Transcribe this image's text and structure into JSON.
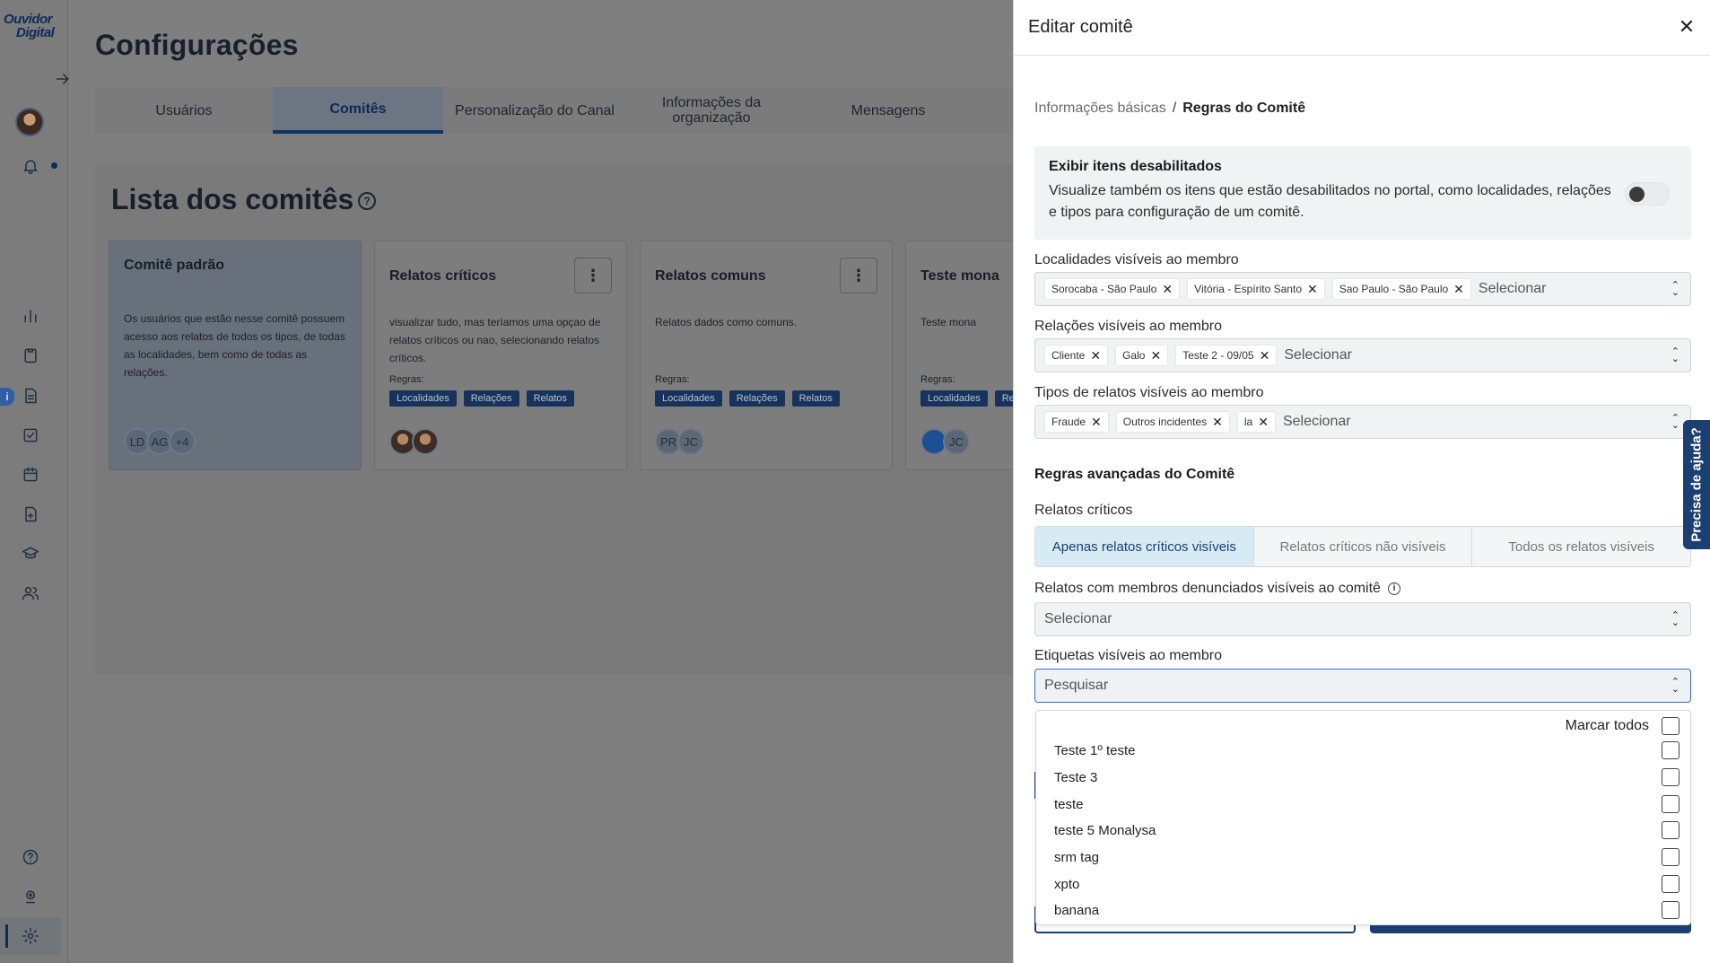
{
  "app": {
    "logo_line1": "Ouvidor",
    "logo_line2": "Digital",
    "page_title": "Configurações"
  },
  "tabs": [
    {
      "label": "Usuários"
    },
    {
      "label": "Comitês",
      "active": true
    },
    {
      "label": "Personalização do Canal"
    },
    {
      "label": "Informações da organização"
    },
    {
      "label": "Mensagens"
    }
  ],
  "committees_section": {
    "title": "Lista dos comitês",
    "help_icon": "help-circle-icon",
    "rules_label": "Regras:",
    "rule_tags": [
      "Localidades",
      "Relações",
      "Relatos"
    ],
    "cards": [
      {
        "title": "Comitê padrão",
        "description": "Os usuários que estão nesse comitê possuem acesso aos relatos de todos os tipos, de todas as localidades, bem como de todas as relações.",
        "avatars": [
          "LD",
          "AG",
          "+4"
        ]
      },
      {
        "title": "Relatos críticos",
        "description": "visualizar tudo, mas teríamos uma opçao de relatos críticos ou nao, selecionando relatos críticos.",
        "menu": "⋮"
      },
      {
        "title": "Relatos comuns",
        "description": "Relatos dados como comuns.",
        "avatars": [
          "PR",
          "JC"
        ],
        "menu": "⋮"
      },
      {
        "title": "Teste mona",
        "description": "Teste mona",
        "avatars": [
          "JC"
        ]
      }
    ]
  },
  "drawer": {
    "title": "Editar comitê",
    "close_icon": "close-icon",
    "breadcrumb": {
      "step1": "Informações básicas",
      "separator": "/",
      "step2": "Regras do Comitê"
    },
    "disabled_items": {
      "title": "Exibir itens desabilitados",
      "text": "Visualize também os itens que estão desabilitados no portal, como localidades, relações e tipos para configuração de um comitê.",
      "enabled": false
    },
    "localities": {
      "label": "Localidades visíveis ao membro",
      "chips": [
        "Sorocaba - São Paulo",
        "Vitória - Espírito Santo",
        "Sao Paulo - São Paulo"
      ],
      "placeholder": "Selecionar"
    },
    "relations": {
      "label": "Relações visíveis ao membro",
      "chips": [
        "Cliente",
        "Galo",
        "Teste 2 - 09/05"
      ],
      "placeholder": "Selecionar"
    },
    "report_types": {
      "label": "Tipos de relatos visíveis ao membro",
      "chips": [
        "Fraude",
        "Outros incidentes",
        "la"
      ],
      "placeholder": "Selecionar"
    },
    "advanced_title": "Regras avançadas do Comitê",
    "critical": {
      "label": "Relatos críticos",
      "options": [
        "Apenas relatos críticos visíveis",
        "Relatos críticos não visíveis",
        "Todos os relatos visíveis"
      ],
      "selected_index": 0
    },
    "reported_members": {
      "label": "Relatos com membros denunciados visíveis ao comitê",
      "placeholder": "Selecionar"
    },
    "tags": {
      "label": "Etiquetas visíveis ao membro",
      "placeholder": "Pesquisar",
      "select_all": "Marcar todos",
      "options": [
        "Teste 1º teste",
        "Teste 3",
        "teste",
        "teste 5 Monalysa",
        "srm tag",
        "xpto",
        "banana"
      ]
    }
  },
  "help_tab": "Precisa de ajuda?",
  "colors": {
    "brand": "#1c3f72",
    "active_segment": "#d7ebf5",
    "overlay": "#7f7f80"
  }
}
